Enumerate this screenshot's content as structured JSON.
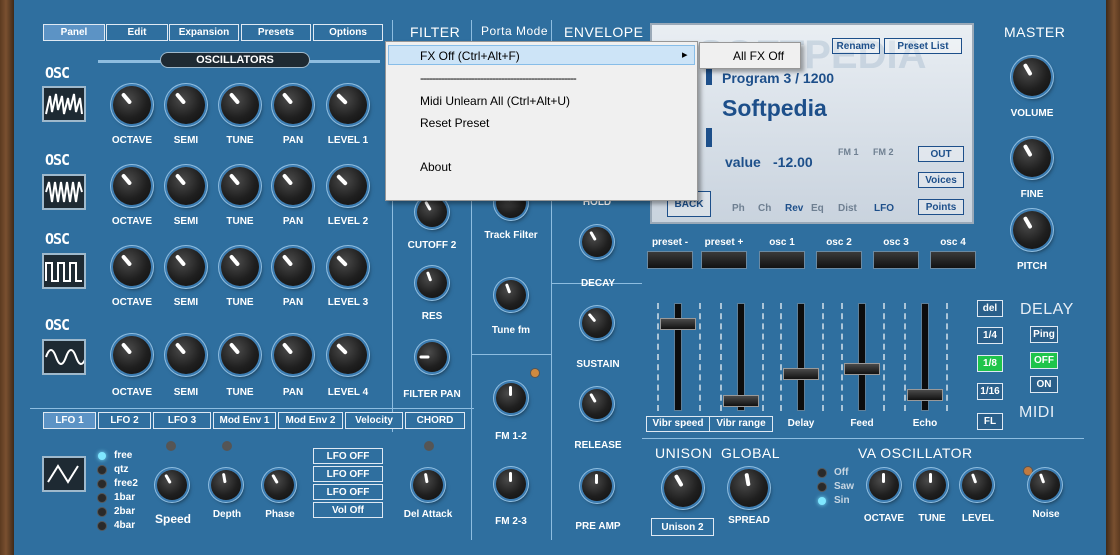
{
  "top_tabs": [
    "Panel",
    "Edit",
    "Expansion",
    "Presets",
    "Options"
  ],
  "sections": {
    "filter": "FILTER",
    "porta": "Porta Mode",
    "envelope": "ENVELOPE",
    "master": "MASTER",
    "oscillators": "OSCILLATORS",
    "unison": "UNISON",
    "global": "GLOBAL",
    "va_osc": "VA OSCILLATOR",
    "delay": "DELAY",
    "midi": "MIDI"
  },
  "osc_badge": "OSC",
  "osc_knob_labels": [
    "OCTAVE",
    "SEMI",
    "TUNE",
    "PAN"
  ],
  "osc_levels": [
    "LEVEL 1",
    "LEVEL 2",
    "LEVEL 3",
    "LEVEL 4"
  ],
  "filter_labels": {
    "cutoff2": "CUTOFF 2",
    "res": "RES",
    "filter_pan": "FILTER PAN"
  },
  "porta_labels": {
    "track_filter": "Track Filter",
    "tune_fm": "Tune fm",
    "fm12": "FM 1-2",
    "fm23": "FM 2-3"
  },
  "env_labels": {
    "hold": "HOLD",
    "decay": "DECAY",
    "sustain": "SUSTAIN",
    "release": "RELEASE",
    "pre_amp": "PRE AMP"
  },
  "master_labels": {
    "volume": "VOLUME",
    "fine": "FINE",
    "pitch": "PITCH"
  },
  "lcd": {
    "buttons": {
      "rename": "Rename",
      "preset_list": "Preset List",
      "out": "OUT",
      "voices": "Voices",
      "points": "Points",
      "back": "BACK"
    },
    "program": "Program 3 / 1200",
    "name": "Softpedia",
    "value_label": "value",
    "value": "-12.00",
    "fm1": "FM 1",
    "fm2": "FM 2",
    "bottom": [
      "Ph",
      "Ch",
      "Rev",
      "Eq",
      "Dist",
      "LFO"
    ]
  },
  "pad_labels": [
    "preset -",
    "preset +",
    "osc 1",
    "osc 2",
    "osc 3",
    "osc 4"
  ],
  "slider_labels": [
    "Vibr speed",
    "Vibr range",
    "Delay",
    "Feed",
    "Echo"
  ],
  "slider_values": [
    0.84,
    0.04,
    0.32,
    0.38,
    0.1
  ],
  "delay_buttons": {
    "del": "del",
    "q": "1/4",
    "e": "1/8",
    "s": "1/16",
    "fl": "FL",
    "ping": "Ping",
    "off": "OFF",
    "on": "ON"
  },
  "lfo_tabs": [
    "LFO 1",
    "LFO 2",
    "LFO 3",
    "Mod Env 1",
    "Mod Env 2",
    "Velocity",
    "CHORD"
  ],
  "lfo_modes": [
    "free",
    "qtz",
    "free2",
    "1bar",
    "2bar",
    "4bar"
  ],
  "lfo_knobs": {
    "speed": "Speed",
    "depth": "Depth",
    "phase": "Phase",
    "del_attack": "Del Attack"
  },
  "lfo_off_buttons": [
    "LFO OFF",
    "LFO OFF",
    "LFO OFF",
    "Vol Off"
  ],
  "unison_button": "Unison 2",
  "spread": "SPREAD",
  "va_waves": [
    "Off",
    "Saw",
    "Sin"
  ],
  "va_knobs": [
    "OCTAVE",
    "TUNE",
    "LEVEL"
  ],
  "noise": "Noise",
  "context_menu": {
    "fx_off": "FX Off  (Ctrl+Alt+F)",
    "separator": "----------------------------------------------------",
    "midi_unlearn": "Midi Unlearn All  (Ctrl+Alt+U)",
    "reset_preset": "Reset Preset",
    "about": "About",
    "submenu_arrow": "▸",
    "submenu_all_fx_off": "All FX Off"
  },
  "watermark": "SOFTPEDIA",
  "colors": {
    "panel": "#2f6f9f",
    "accent_green": "#22c55e",
    "lcd_text": "#1d4f8a"
  }
}
